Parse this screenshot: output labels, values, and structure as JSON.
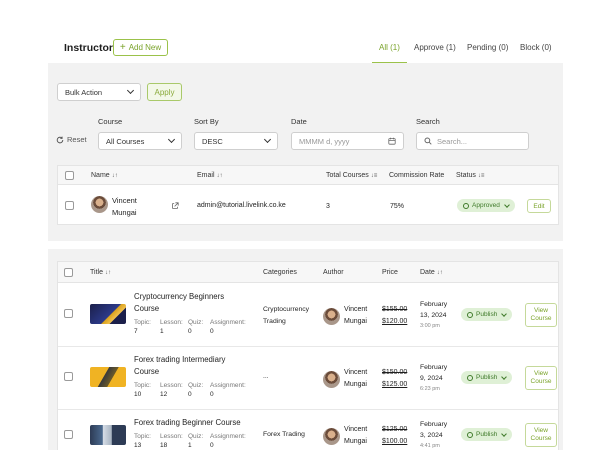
{
  "header": {
    "title": "Instructor",
    "add_new": "Add New",
    "tabs": [
      {
        "label": "All (1)",
        "active": true
      },
      {
        "label": "Approve (1)",
        "active": false
      },
      {
        "label": "Pending (0)",
        "active": false
      },
      {
        "label": "Block (0)",
        "active": false
      }
    ]
  },
  "filters": {
    "bulk_action": "Bulk Action",
    "apply": "Apply",
    "reset": "Reset",
    "course_label": "Course",
    "course_value": "All Courses",
    "sort_label": "Sort By",
    "sort_value": "DESC",
    "date_label": "Date",
    "date_placeholder": "MMMM d, yyyy",
    "search_label": "Search",
    "search_placeholder": "Search..."
  },
  "instructors": {
    "columns": [
      "Name",
      "Email",
      "Total Courses",
      "Commission Rate",
      "Status"
    ],
    "rows": [
      {
        "name_first": "Vincent",
        "name_last": "Mungai",
        "email": "admin@tutorial.livelink.co.ke",
        "total_courses": "3",
        "commission": "75%",
        "status": "Approved",
        "edit": "Edit"
      }
    ]
  },
  "courses": {
    "columns": [
      "Title",
      "Categories",
      "Author",
      "Price",
      "Date"
    ],
    "meta_labels": [
      "Topic:",
      "Lesson:",
      "Quiz:",
      "Assignment:"
    ],
    "rows": [
      {
        "title_1": "Cryptocurrency Beginners",
        "title_2": "Course",
        "topic": "7",
        "lesson": "1",
        "quiz": "0",
        "assignment": "0",
        "category_1": "Cryptocurrency",
        "category_2": "Trading",
        "author_1": "Vincent",
        "author_2": "Mungai",
        "price_old": "$155.00",
        "price_new": "$120.00",
        "date_1": "February",
        "date_2": "13, 2024",
        "time": "3:00 pm",
        "status": "Publish",
        "view_1": "View",
        "view_2": "Course"
      },
      {
        "title_1": "Forex trading Intermediary",
        "title_2": "Course",
        "topic": "10",
        "lesson": "12",
        "quiz": "0",
        "assignment": "0",
        "category_1": "...",
        "category_2": "",
        "author_1": "Vincent",
        "author_2": "Mungai",
        "price_old": "$150.00",
        "price_new": "$125.00",
        "date_1": "February",
        "date_2": "9, 2024",
        "time": "6:23 pm",
        "status": "Publish",
        "view_1": "View",
        "view_2": "Course"
      },
      {
        "title_1": "Forex trading Beginner Course",
        "title_2": "",
        "topic": "13",
        "lesson": "18",
        "quiz": "1",
        "assignment": "0",
        "category_1": "Forex Trading",
        "category_2": "",
        "author_1": "Vincent",
        "author_2": "Mungai",
        "price_old": "$125.00",
        "price_new": "$100.00",
        "date_1": "February",
        "date_2": "3, 2024",
        "time": "4:41 pm",
        "status": "Publish",
        "view_1": "View",
        "view_2": "Course"
      }
    ]
  },
  "colors": {
    "accent": "#7aa32a",
    "status_bg": "#dff0d6",
    "panel_bg": "#f2f2f2"
  },
  "icons": [
    "plus-icon",
    "reset-icon",
    "calendar-icon",
    "search-icon",
    "external-link-icon",
    "sort-icon",
    "check-circle-icon",
    "chevron-down-icon"
  ]
}
